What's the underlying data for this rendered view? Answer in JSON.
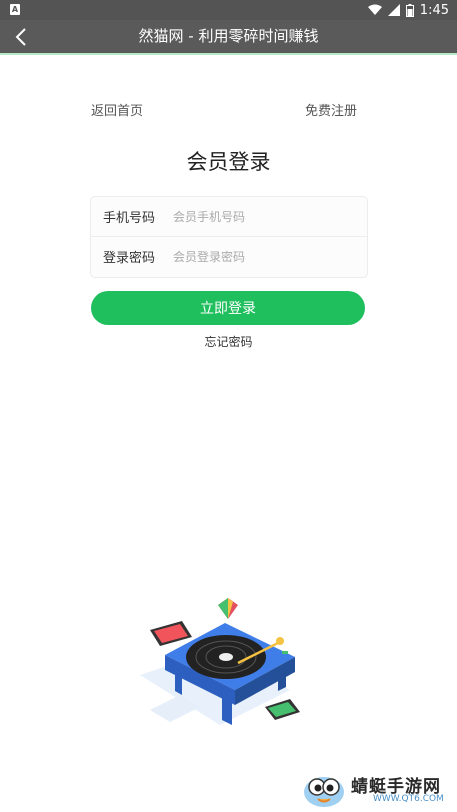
{
  "status_bar": {
    "time": "1:45",
    "left_indicator": "A"
  },
  "title_bar": {
    "title": "然猫网 - 利用零碎时间赚钱"
  },
  "top_links": {
    "home": "返回首页",
    "register": "免费注册"
  },
  "heading": "会员登录",
  "form": {
    "phone_label": "手机号码",
    "phone_placeholder": "会员手机号码",
    "password_label": "登录密码",
    "password_placeholder": "会员登录密码"
  },
  "login_button": "立即登录",
  "forgot_password": "忘记密码",
  "watermark": {
    "title": "蜻蜓手游网",
    "url": "WWW.QT6.COM"
  },
  "colors": {
    "accent": "#1fbf5e",
    "titlebar": "#5a5a5a",
    "statusbar": "#545454"
  }
}
